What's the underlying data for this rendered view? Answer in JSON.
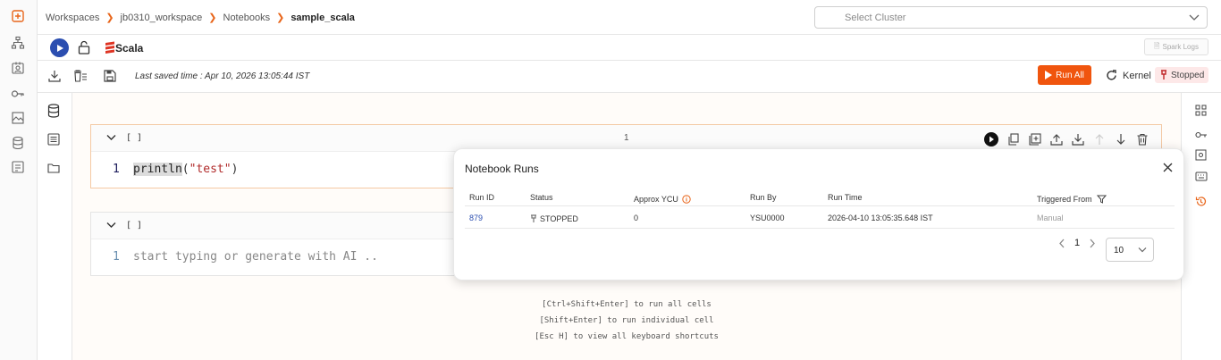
{
  "breadcrumbs": [
    "Workspaces",
    "jb0310_workspace",
    "Notebooks",
    "sample_scala"
  ],
  "cluster": {
    "placeholder": "Select Cluster"
  },
  "toolbar": {
    "language": "Scala",
    "spark_logs_label": "Spark Logs",
    "last_saved": "Last saved time : Apr 10, 2026 13:05:44 IST",
    "run_all_label": "Run All",
    "kernel_label": "Kernel",
    "kernel_status": "Stopped"
  },
  "cells": [
    {
      "brackets": "[ ]",
      "number": "1",
      "line": "1",
      "code_fn": "println",
      "code_open": "(",
      "code_str": "\"test\"",
      "code_close": ")"
    },
    {
      "brackets": "[ ]",
      "line": "1",
      "placeholder": "start typing or generate with AI .."
    }
  ],
  "shortcuts": [
    "[Ctrl+Shift+Enter] to run all cells",
    "[Shift+Enter] to run individual cell",
    "[Esc H] to view all keyboard shortcuts"
  ],
  "runs_popup": {
    "title": "Notebook Runs",
    "columns": [
      "Run ID",
      "Status",
      "Approx YCU",
      "Run By",
      "Run Time",
      "Triggered From"
    ],
    "rows": [
      {
        "run_id": "879",
        "status": "STOPPED",
        "ycu": "0",
        "run_by": "YSU0000",
        "run_time": "2026-04-10 13:05:35.648 IST",
        "triggered_from": "Manual"
      }
    ],
    "page": "1",
    "page_size": "10"
  },
  "colors": {
    "accent": "#f0550e",
    "primary": "#2b4eb0",
    "stopped_bg": "#fde8e8"
  }
}
